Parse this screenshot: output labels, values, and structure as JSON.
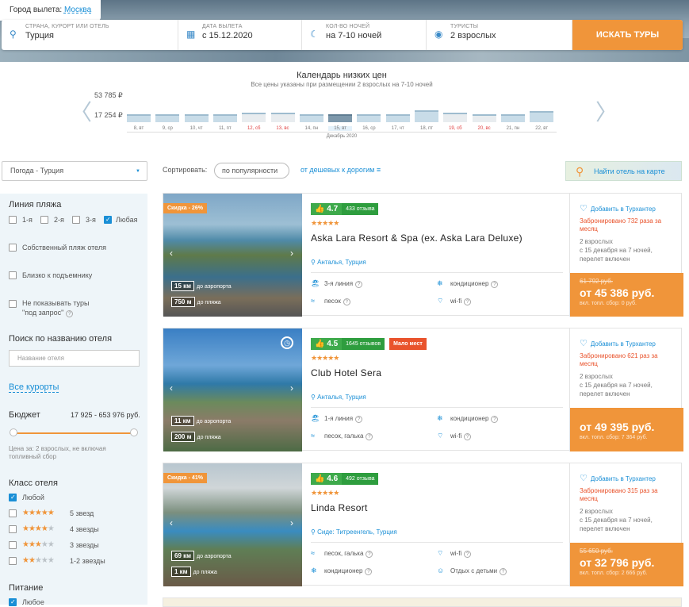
{
  "header": {
    "departure_label": "Город вылета:",
    "departure_city": "Москва"
  },
  "search": {
    "fields": [
      {
        "name": "destination",
        "label": "СТРАНА, КУРОРТ ИЛИ ОТЕЛЬ",
        "value": "Турция",
        "icon": "map-pin-icon"
      },
      {
        "name": "date",
        "label": "ДАТА ВЫЛЕТА",
        "value": "с 15.12.2020",
        "icon": "calendar-icon"
      },
      {
        "name": "nights",
        "label": "КОЛ-ВО НОЧЕЙ",
        "value": "на 7-10 ночей",
        "icon": "moon-icon"
      },
      {
        "name": "tourists",
        "label": "ТУРИСТЫ",
        "value": "2 взрослых",
        "icon": "user-icon"
      }
    ],
    "button": "ИСКАТЬ ТУРЫ"
  },
  "calendar": {
    "title": "Календарь низких цен",
    "subtitle": "Все цены указаны при размещении 2 взрослых на 7-10 ночей",
    "max_price": "53 785 ₽",
    "min_price": "17 254 ₽",
    "month": "Декабрь 2020",
    "days": [
      {
        "label": "8, вт",
        "level": 0.3,
        "weekend": false
      },
      {
        "label": "9, ср",
        "level": 0.3,
        "weekend": false
      },
      {
        "label": "10, чт",
        "level": 0.3,
        "weekend": false
      },
      {
        "label": "11, пт",
        "level": 0.3,
        "weekend": false
      },
      {
        "label": "12, сб",
        "level": 0.4,
        "weekend": true
      },
      {
        "label": "13, вс",
        "level": 0.4,
        "weekend": true
      },
      {
        "label": "14, пн",
        "level": 0.3,
        "weekend": false
      },
      {
        "label": "15, вт",
        "level": 0.3,
        "weekend": false,
        "selected": true
      },
      {
        "label": "16, ср",
        "level": 0.3,
        "weekend": false
      },
      {
        "label": "17, чт",
        "level": 0.3,
        "weekend": false
      },
      {
        "label": "18, пт",
        "level": 0.55,
        "weekend": false
      },
      {
        "label": "19, сб",
        "level": 0.4,
        "weekend": true
      },
      {
        "label": "20, вс",
        "level": 0.3,
        "weekend": true
      },
      {
        "label": "21, пн",
        "level": 0.3,
        "weekend": false
      },
      {
        "label": "22, вт",
        "level": 0.5,
        "weekend": false
      }
    ]
  },
  "filters": {
    "weather": "Погода - Турция",
    "beach_title": "Линия пляжа",
    "beach_options": [
      "1-я",
      "2-я",
      "3-я",
      "Любая"
    ],
    "own_beach": "Собственный пляж отеля",
    "near_lift": "Близко к подъемнику",
    "no_request": "Не показывать туры",
    "no_request2": "\"под запрос\"",
    "hotel_search_title": "Поиск по названию отеля",
    "hotel_search_placeholder": "Название отеля",
    "all_resorts": "Все курорты",
    "budget_title": "Бюджет",
    "budget_range": "17 925 - 653 976 руб.",
    "price_note": "Цена за: 2 взрослых, не включая топливный сбор",
    "class_title": "Класс отеля",
    "class_any": "Любой",
    "class_opts": [
      "5 звезд",
      "4 звезды",
      "3 звезды",
      "1-2 звезды"
    ],
    "food_title": "Питание",
    "food_any": "Любое"
  },
  "sort": {
    "label": "Сортировать:",
    "popular": "по популярности",
    "cheap": "от дешевых к дорогим ≡"
  },
  "map_button": "Найти отель на карте",
  "hotels": [
    {
      "discount": "Скидка - 26%",
      "score": "4.7",
      "reviews": "433 отзыва",
      "few": "",
      "name": "Aska Lara Resort & Spa (ex. Aska Lara Deluxe)",
      "location": "Анталья, Турция",
      "airport": "15 км",
      "airport_label": "до аэропорта",
      "beach": "750 м",
      "beach_label": "до пляжа",
      "features": [
        {
          "t": "3-я линия",
          "i": "🏖"
        },
        {
          "t": "кондиционер",
          "i": "❄"
        },
        {
          "t": "песок",
          "i": "≈"
        },
        {
          "t": "wi-fi",
          "i": "⌔"
        }
      ],
      "fav": "Добавить в Турхантер",
      "booked": "Забронировано 732 раза за месяц",
      "tourists": "2 взрослых",
      "dates": "с 15 декабря на 7 ночей,",
      "flight": "перелет включен",
      "old_price": "61 792 руб.",
      "price": "от 45 386 руб.",
      "tax": "вкл. топл. сбор: 0 руб."
    },
    {
      "discount": "",
      "score": "4.5",
      "reviews": "1645 отзывов",
      "few": "Мало мест",
      "name": "Club Hotel Sera",
      "location": "Анталья, Турция",
      "airport": "11 км",
      "airport_label": "до аэропорта",
      "beach": "200 м",
      "beach_label": "до пляжа",
      "features": [
        {
          "t": "1-я линия",
          "i": "🏖"
        },
        {
          "t": "кондиционер",
          "i": "❄"
        },
        {
          "t": "песок, галька",
          "i": "≈"
        },
        {
          "t": "wi-fi",
          "i": "⌔"
        }
      ],
      "fav": "Добавить в Турхантер",
      "booked": "Забронировано 621 раз за месяц",
      "tourists": "2 взрослых",
      "dates": "с 15 декабря на 7 ночей,",
      "flight": "перелет включен",
      "old_price": "",
      "price": "от 49 395 руб.",
      "tax": "вкл. топл. сбор: 7 364 руб."
    },
    {
      "discount": "Скидка - 41%",
      "score": "4.6",
      "reviews": "492 отзыва",
      "few": "",
      "name": "Linda Resort",
      "location": "Сиде: Титреенгель, Турция",
      "airport": "69 км",
      "airport_label": "до аэропорта",
      "beach": "1 км",
      "beach_label": "до пляжа",
      "features": [
        {
          "t": "песок, галька",
          "i": "≈"
        },
        {
          "t": "wi-fi",
          "i": "⌔"
        },
        {
          "t": "кондиционер",
          "i": "❄"
        },
        {
          "t": "Отдых с детьми",
          "i": "☺"
        }
      ],
      "fav": "Добавить в Турхантер",
      "booked": "Забронировано 315 раз за месяц",
      "tourists": "2 взрослых",
      "dates": "с 15 декабря на 7 ночей,",
      "flight": "перелет включен",
      "old_price": "55 650 руб.",
      "price": "от 32 796 руб.",
      "tax": "вкл. топл. сбор: 2 666 руб."
    }
  ]
}
